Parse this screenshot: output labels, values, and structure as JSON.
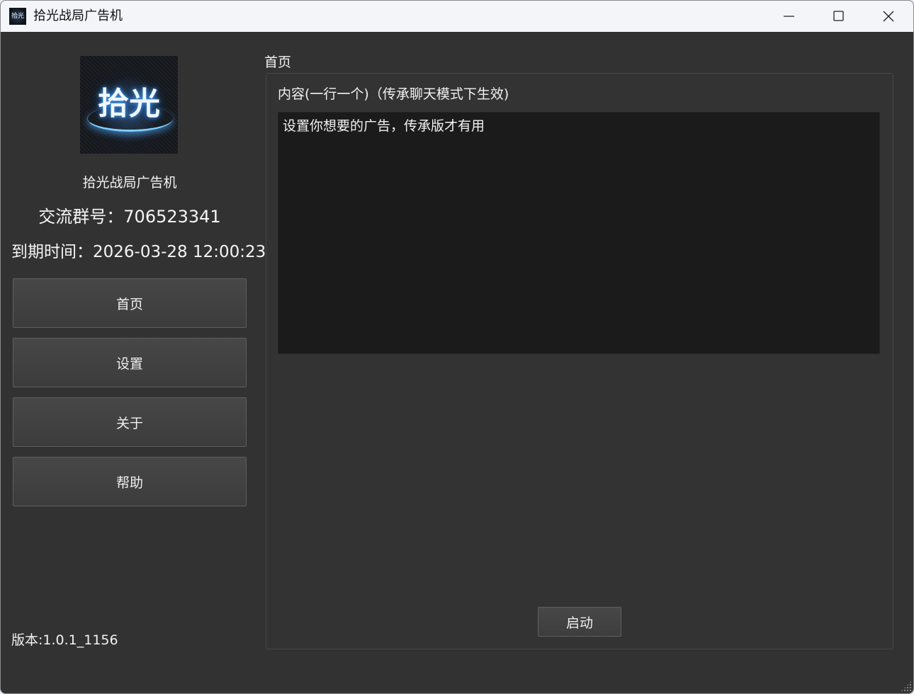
{
  "window": {
    "title": "拾光战局广告机",
    "icon": "app-logo-icon"
  },
  "sidebar": {
    "logo_text": "拾光",
    "app_name": "拾光战局广告机",
    "group_label": "交流群号：706523341",
    "expire_label": "到期时间：2026-03-28 12:00:23",
    "nav": [
      {
        "label": "首页"
      },
      {
        "label": "设置"
      },
      {
        "label": "关于"
      },
      {
        "label": "帮助"
      }
    ],
    "version": "版本:1.0.1_1156"
  },
  "main": {
    "section_title": "首页",
    "content_label": "内容(一行一个)（传承聊天模式下生效)",
    "content_value": "设置你想要的广告，传承版才有用",
    "start_label": "启动"
  },
  "colors": {
    "background": "#323232",
    "textarea": "#1b1b1b",
    "titlebar": "#f3f5f8",
    "text": "#f2f2f2"
  }
}
